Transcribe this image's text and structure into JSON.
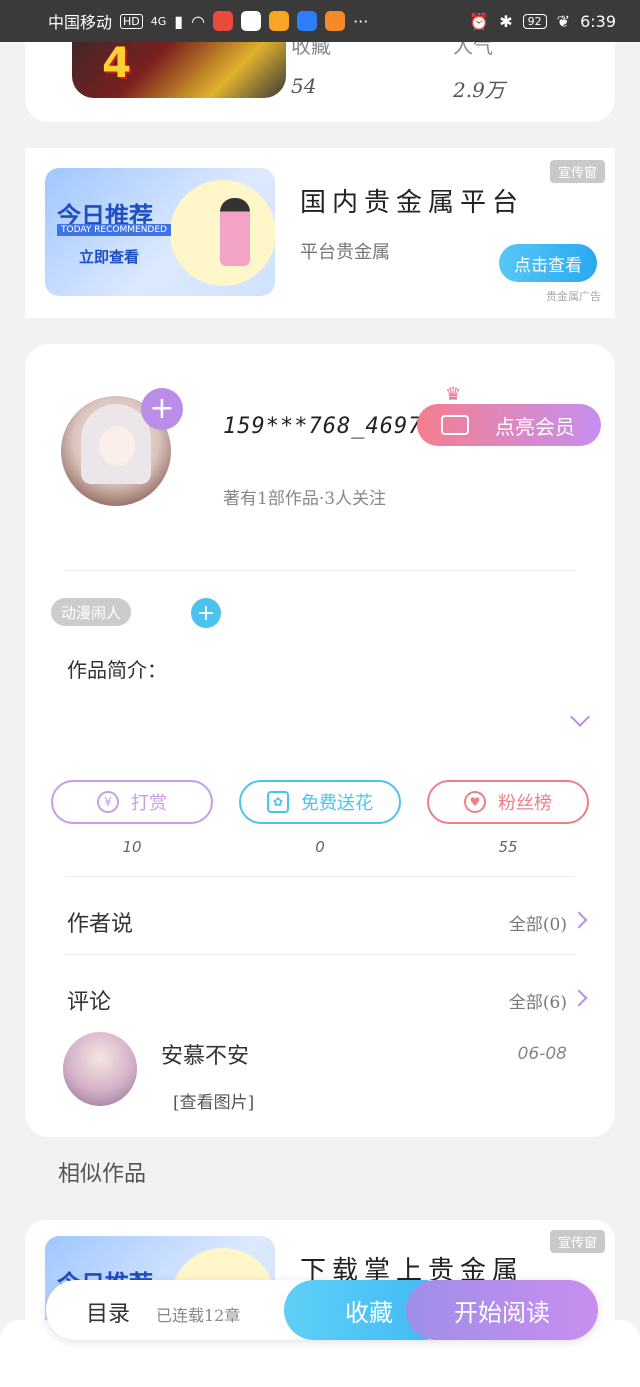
{
  "status_bar": {
    "carrier": "中国移动",
    "hd": "HD",
    "network": "4G",
    "battery": "92",
    "time": "6:39",
    "more": "···"
  },
  "top_card": {
    "stats": [
      {
        "label": "收藏",
        "value": "54"
      },
      {
        "label": "人气",
        "value": "2.9万"
      }
    ],
    "game_text": "4"
  },
  "ads": [
    {
      "image": {
        "title": "今日推荐",
        "subtitle": "TODAY RECOMMENDED",
        "cta": "立即查看"
      },
      "title": "国内贵金属平台",
      "subtitle": "平台贵金属",
      "tag": "宣传窗",
      "button": "点击查看",
      "footer": "贵金属广告"
    },
    {
      "image": {
        "title": "今日推荐",
        "subtitle": "",
        "cta": ""
      },
      "title": "下载掌上贵金属",
      "subtitle": "",
      "tag": "宣传窗",
      "button": "",
      "footer": ""
    }
  ],
  "profile": {
    "username": "159***768_46972...",
    "vip_label": "点亮会员",
    "bio": "著有1部作品·3人关注",
    "tag": "动漫闹人",
    "intro_label": "作品简介："
  },
  "actions": [
    {
      "label": "打赏",
      "icon": "yen-icon",
      "count": "10",
      "color": "#c79ce8"
    },
    {
      "label": "免费送花",
      "icon": "flower-icon",
      "count": "0",
      "color": "#4cc3ef"
    },
    {
      "label": "粉丝榜",
      "icon": "person-heart-icon",
      "count": "55",
      "color": "#ef7f86"
    }
  ],
  "sections": {
    "author_say": {
      "title": "作者说",
      "all": "全部(0)"
    },
    "comments": {
      "title": "评论",
      "all": "全部(6)"
    }
  },
  "comment": {
    "name": "安慕不安",
    "image_link": "[查看图片]",
    "date": "06-08"
  },
  "similar_title": "相似作品",
  "bottom_bar": {
    "catalog": "目录",
    "serial": "已连载12章",
    "favorite": "收藏",
    "read": "开始阅读"
  }
}
